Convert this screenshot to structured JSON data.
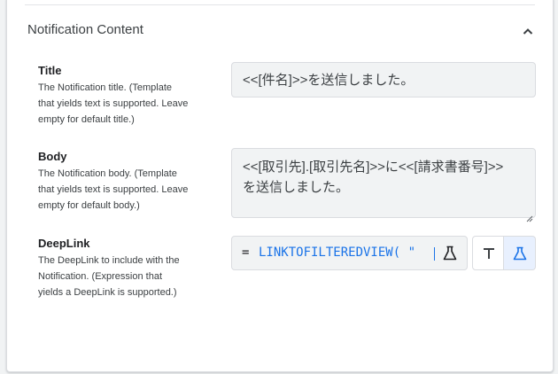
{
  "section": {
    "title": "Notification Content"
  },
  "fields": [
    {
      "title": "Title",
      "description": [
        "The Notification title. (Template",
        "that yields text is supported. Leave",
        "empty for default title.)"
      ],
      "value": "<<[件名]>>を送信しました。"
    },
    {
      "title": "Body",
      "description": [
        "The Notification body. (Template",
        "that yields text is supported. Leave",
        "empty for default body.)"
      ],
      "value_lines": [
        "<<[取引先].[取引先名]>>に<<[請求書番号]>>",
        "を送信しました。"
      ]
    },
    {
      "title": "DeepLink",
      "description": [
        "The DeepLink to include with the",
        "Notification. (Expression that",
        "yields a DeepLink is supported.)"
      ],
      "expr_prefix": "=",
      "expr_value": "LINKTOFILTEREDVIEW( \""
    }
  ],
  "colors": {
    "accent": "#1a73e8",
    "field_bg": "#f1f3f4",
    "selected_bg": "#e8f0fe"
  },
  "icons": {
    "collapse": "chevron-up-icon",
    "test": "flask-icon",
    "text_mode": "text-t-icon",
    "expr_mode": "flask-icon"
  }
}
